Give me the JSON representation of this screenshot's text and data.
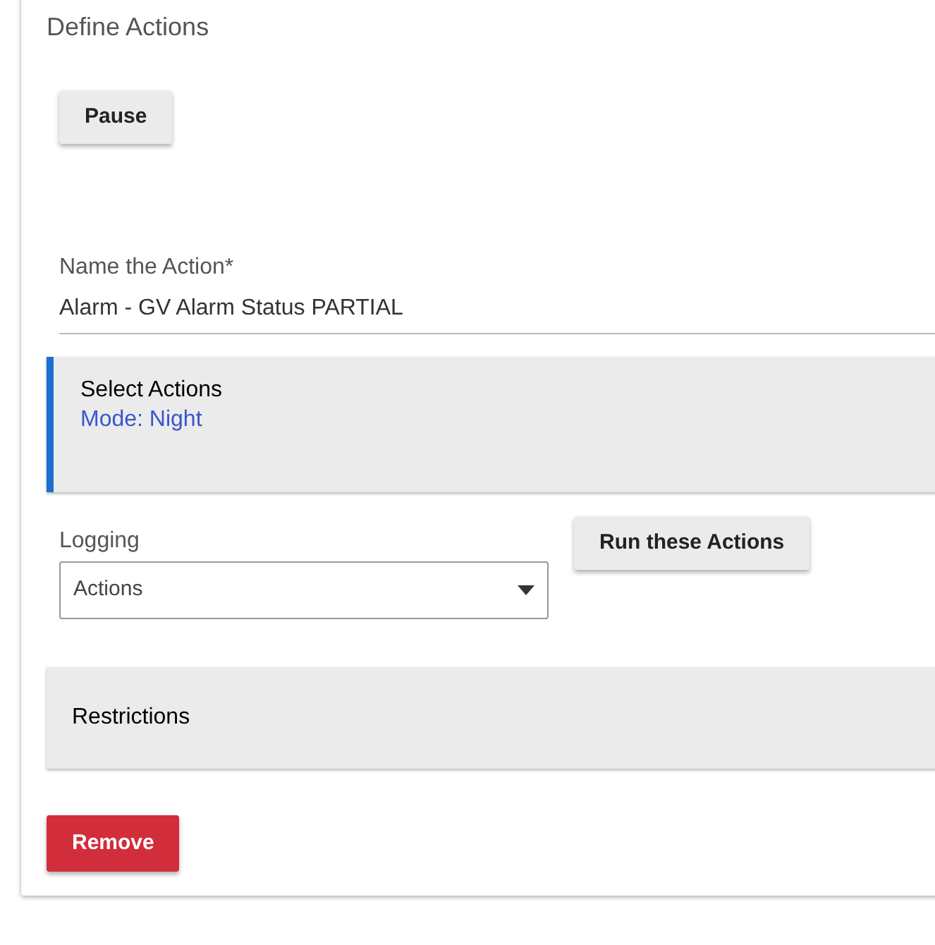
{
  "section_title": "Define Actions",
  "pause_button": "Pause",
  "name_field": {
    "label": "Name the Action*",
    "value": "Alarm - GV Alarm Status PARTIAL"
  },
  "select_actions": {
    "title": "Select Actions",
    "items": [
      "Mode: Night"
    ]
  },
  "logging": {
    "label": "Logging",
    "value": "Actions"
  },
  "run_button": "Run these Actions",
  "restrictions": {
    "title": "Restrictions"
  },
  "remove_button": "Remove"
}
